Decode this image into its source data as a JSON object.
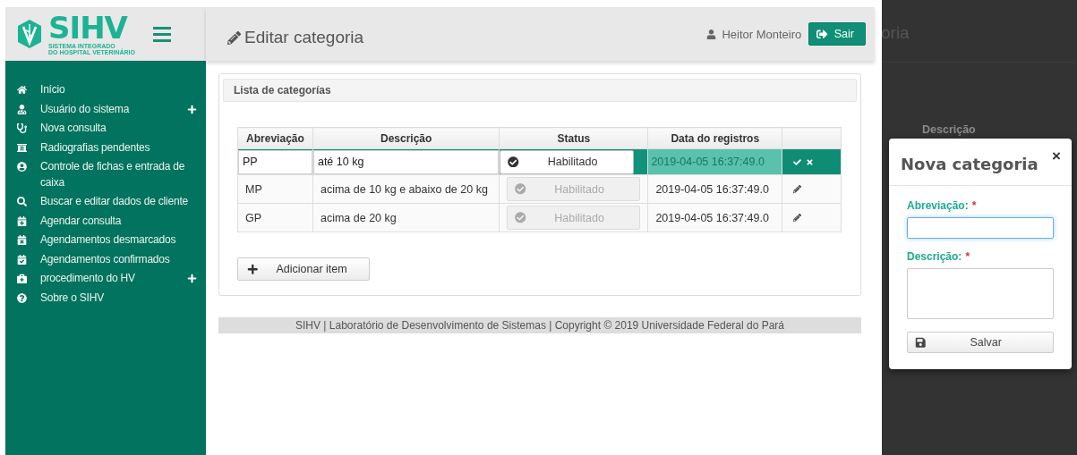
{
  "logo": {
    "title": "SIHV",
    "subtitle": [
      "SISTEMA INTEGRADO",
      "DO HOSPITAL VETERINÁRIO"
    ]
  },
  "sidebar": {
    "items": [
      {
        "label": "Início",
        "expandable": false
      },
      {
        "label": "Usuário do sistema",
        "expandable": true
      },
      {
        "label": "Nova consulta",
        "expandable": false
      },
      {
        "label": "Radiografias pendentes",
        "expandable": false
      },
      {
        "label": "Controle de fichas e entrada de caixa",
        "expandable": false
      },
      {
        "label": "Buscar e editar dados de cliente",
        "expandable": false
      },
      {
        "label": "Agendar consulta",
        "expandable": false
      },
      {
        "label": "Agendamentos desmarcados",
        "expandable": false
      },
      {
        "label": "Agendamentos confirmados",
        "expandable": false
      },
      {
        "label": "procedimento do HV",
        "expandable": true
      },
      {
        "label": "Sobre o SIHV",
        "expandable": false
      }
    ]
  },
  "header": {
    "title": "Editar categoria",
    "user": "Heitor Monteiro",
    "logout": "Sair"
  },
  "panel": {
    "title": "Lista de categorías",
    "table": {
      "columns": [
        "Abreviação",
        "Descrição",
        "Status",
        "Data do registros",
        ""
      ],
      "rows": [
        {
          "abbreviation": "PP",
          "description": "até 10 kg",
          "status": "Habilitado",
          "date": "2019-04-05 16:37:49.0",
          "editing": true
        },
        {
          "abbreviation": "MP",
          "description": "acima de 10 kg e abaixo de 20 kg",
          "status": "Habilitado",
          "date": "2019-04-05 16:37:49.0",
          "editing": false
        },
        {
          "abbreviation": "GP",
          "description": "acima de 20 kg",
          "status": "Habilitado",
          "date": "2019-04-05 16:37:49.0",
          "editing": false
        }
      ]
    },
    "add_button": "Adicionar item"
  },
  "footer": "SIHV | Laboratório de Desenvolvimento de Sistemas | Copyright © 2019 Universidade Federal do Pará",
  "background": {
    "title_fragment": "oria",
    "column_fragment": "Descrição"
  },
  "modal": {
    "title": "Nova categoria",
    "close": "×",
    "fields": [
      {
        "label": "Abreviação:",
        "required": "*",
        "kind": "input",
        "focused": true
      },
      {
        "label": "Descrição:",
        "required": "*",
        "kind": "textarea",
        "focused": false
      }
    ],
    "save": "Salvar"
  }
}
